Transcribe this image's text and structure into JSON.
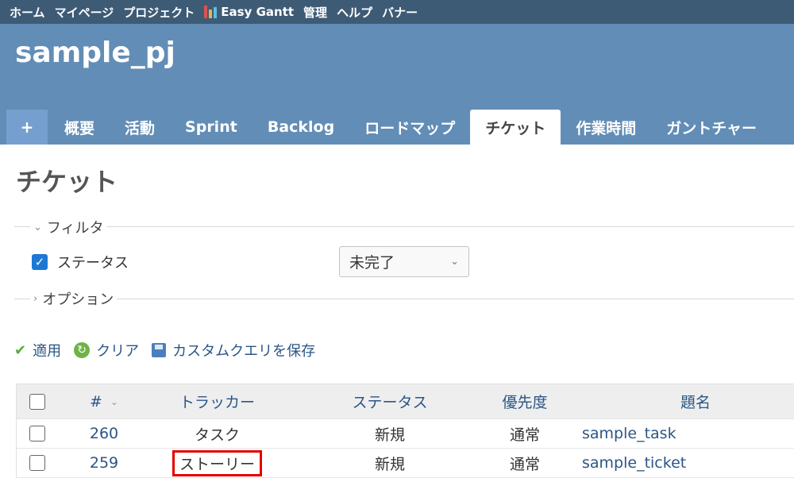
{
  "top_menu": {
    "items": [
      "ホーム",
      "マイページ",
      "プロジェクト"
    ],
    "easy_gantt": "Easy Gantt",
    "items_after": [
      "管理",
      "ヘルプ",
      "バナー"
    ]
  },
  "header": {
    "project_title": "sample_pj",
    "tabs": [
      "+",
      "概要",
      "活動",
      "Sprint",
      "Backlog",
      "ロードマップ",
      "チケット",
      "作業時間",
      "ガントチャー"
    ],
    "selected_tab": "チケット"
  },
  "main": {
    "page_title": "チケット",
    "filters": {
      "legend": "フィルタ",
      "status_label": "ステータス",
      "status_checked": true,
      "status_value": "未完了"
    },
    "options": {
      "legend": "オプション"
    },
    "buttons": {
      "apply": "適用",
      "clear": "クリア",
      "save_query": "カスタムクエリを保存"
    },
    "table": {
      "headers": {
        "id": "#",
        "tracker": "トラッカー",
        "status": "ステータス",
        "priority": "優先度",
        "subject": "題名"
      },
      "rows": [
        {
          "id": "260",
          "tracker": "タスク",
          "status": "新規",
          "priority": "通常",
          "subject": "sample_task",
          "highlighted": false
        },
        {
          "id": "259",
          "tracker": "ストーリー",
          "status": "新規",
          "priority": "通常",
          "subject": "sample_ticket",
          "highlighted": true
        }
      ]
    }
  },
  "colors": {
    "top_menu_bg": "#3e5b76",
    "header_bg": "#628db6",
    "link": "#2a5685",
    "highlight_border": "#e30000"
  }
}
